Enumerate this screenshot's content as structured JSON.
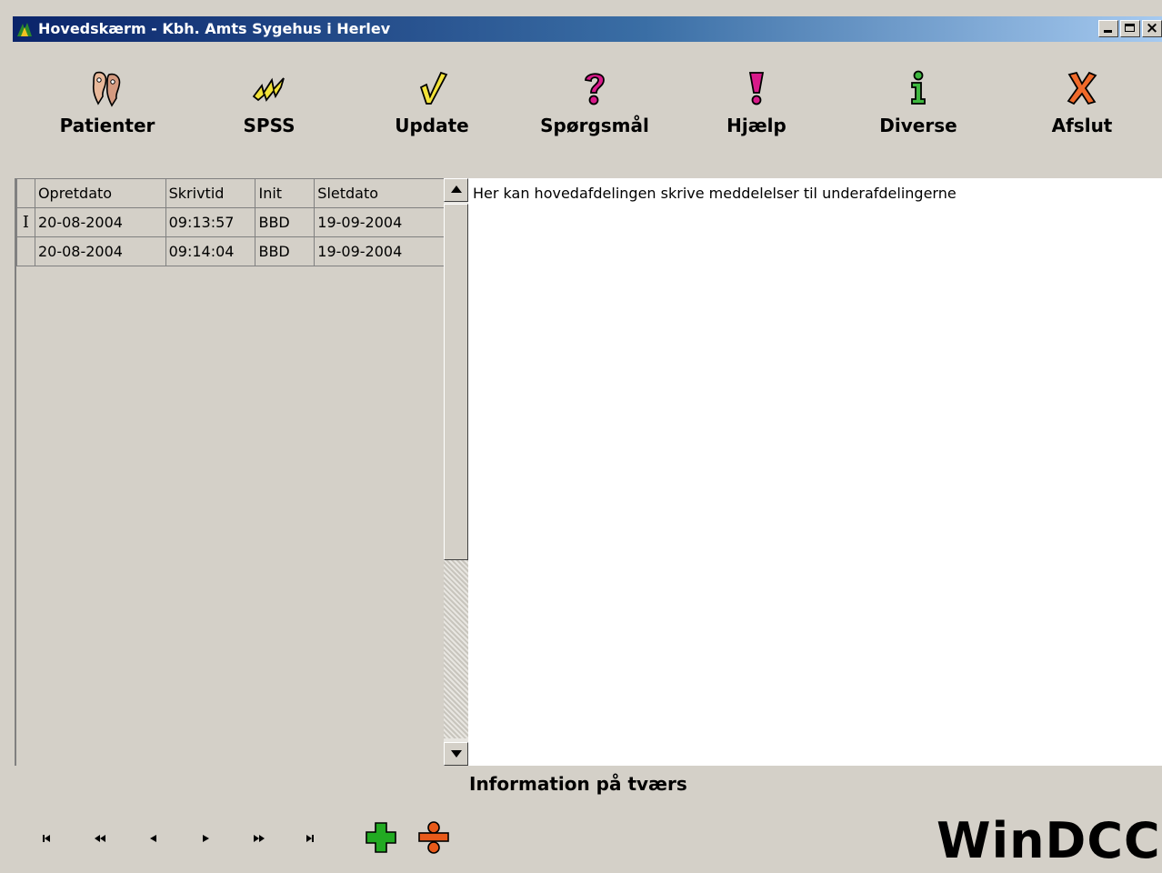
{
  "window": {
    "title": "Hovedskærm - Kbh. Amts Sygehus i Herlev",
    "controls": [
      "minimize-button",
      "maximize-button",
      "close-button"
    ],
    "close_glyph": "×"
  },
  "toolbar": {
    "items": [
      {
        "label": "Patienter",
        "icon": "patients-icon"
      },
      {
        "label": "SPSS",
        "icon": "spss-icon"
      },
      {
        "label": "Update",
        "icon": "checkmark-icon"
      },
      {
        "label": "Spørgsmål",
        "icon": "question-icon"
      },
      {
        "label": "Hjælp",
        "icon": "exclamation-icon"
      },
      {
        "label": "Diverse",
        "icon": "info-icon"
      },
      {
        "label": "Afslut",
        "icon": "exit-x-icon"
      }
    ]
  },
  "grid": {
    "columns": [
      "Opretdato",
      "Skrivtid",
      "Init",
      "Sletdato"
    ],
    "current_row_indicator": "I",
    "rows": [
      [
        "20-08-2004",
        "09:13:57",
        "BBD",
        "19-09-2004"
      ],
      [
        "20-08-2004",
        "09:14:04",
        "BBD",
        "19-09-2004"
      ]
    ]
  },
  "memo": {
    "text": "Her kan hovedafdelingen skrive meddelelser til underafdelingerne"
  },
  "caption": "Information på tværs",
  "navigator": {
    "buttons": [
      "first-record-button",
      "prior-page-button",
      "prior-record-button",
      "next-record-button",
      "next-page-button",
      "last-record-button",
      "add-record-button",
      "delete-record-button"
    ]
  },
  "brand": "WinDCCD",
  "colors": {
    "titlebar_start": "#0a246a",
    "titlebar_end": "#a6caf0",
    "window_bg": "#d4d0c8",
    "add_green": "#22aa22",
    "delete_orange": "#e85a1a",
    "icon_magenta": "#d81a8a"
  }
}
